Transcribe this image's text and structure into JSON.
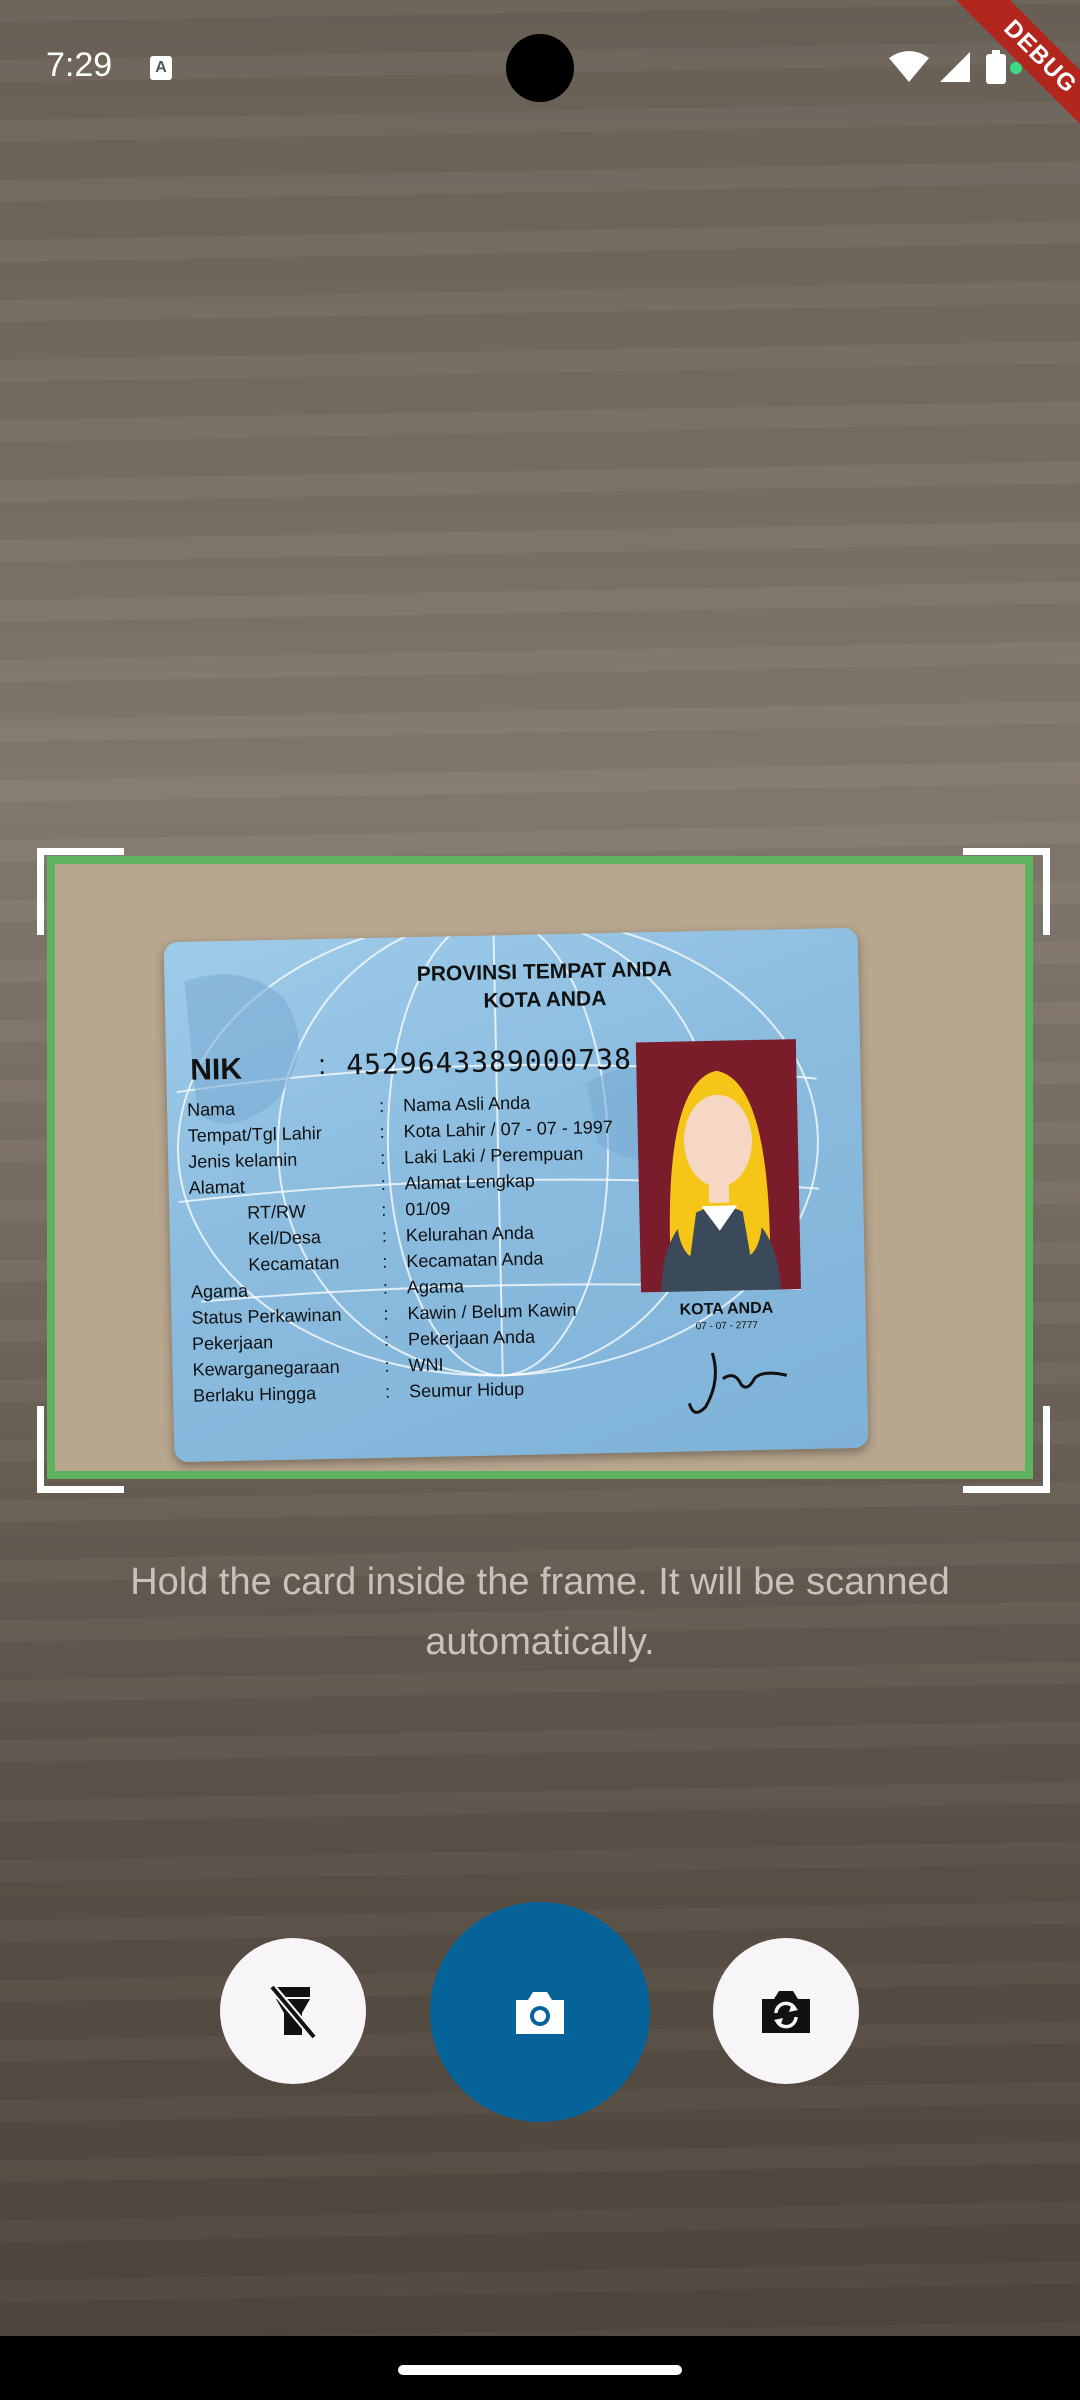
{
  "status_bar": {
    "time": "7:29",
    "notification_icon": "A",
    "debug_banner": "DEBUG"
  },
  "scanner": {
    "frame_color": "#5fb35f",
    "corner_color": "#ffffff",
    "instruction": "Hold the card inside the frame. It will be scanned automatically."
  },
  "id_card": {
    "province": "PROVINSI TEMPAT ANDA",
    "city_header": "KOTA ANDA",
    "nik_label": "NIK",
    "nik_colon": ":",
    "nik_value": "4529643389000738",
    "fields": [
      {
        "label": "Nama",
        "value": "Nama Asli Anda"
      },
      {
        "label": "Tempat/Tgl Lahir",
        "value": "Kota Lahir / 07 - 07 - 1997"
      },
      {
        "label": "Jenis kelamin",
        "value": "Laki Laki / Perempuan"
      },
      {
        "label": "Alamat",
        "value": "Alamat Lengkap"
      },
      {
        "label": "RT/RW",
        "value": "01/09"
      },
      {
        "label": "Kel/Desa",
        "value": "Kelurahan Anda"
      },
      {
        "label": "Kecamatan",
        "value": "Kecamatan Anda"
      },
      {
        "label": "Agama",
        "value": "Agama"
      },
      {
        "label": "Status Perkawinan",
        "value": "Kawin / Belum Kawin"
      },
      {
        "label": "Pekerjaan",
        "value": "Pekerjaan Anda"
      },
      {
        "label": "Kewarganegaraan",
        "value": "WNI"
      },
      {
        "label": "Berlaku Hingga",
        "value": "Seumur Hidup"
      }
    ],
    "photo_city": "KOTA ANDA",
    "photo_date": "07 - 07 - 2777"
  },
  "controls": {
    "flash_icon": "flash-off-icon",
    "shutter_icon": "camera-icon",
    "switch_icon": "switch-camera-icon",
    "shutter_color": "#06639a",
    "button_bg": "#f7f5f8"
  }
}
